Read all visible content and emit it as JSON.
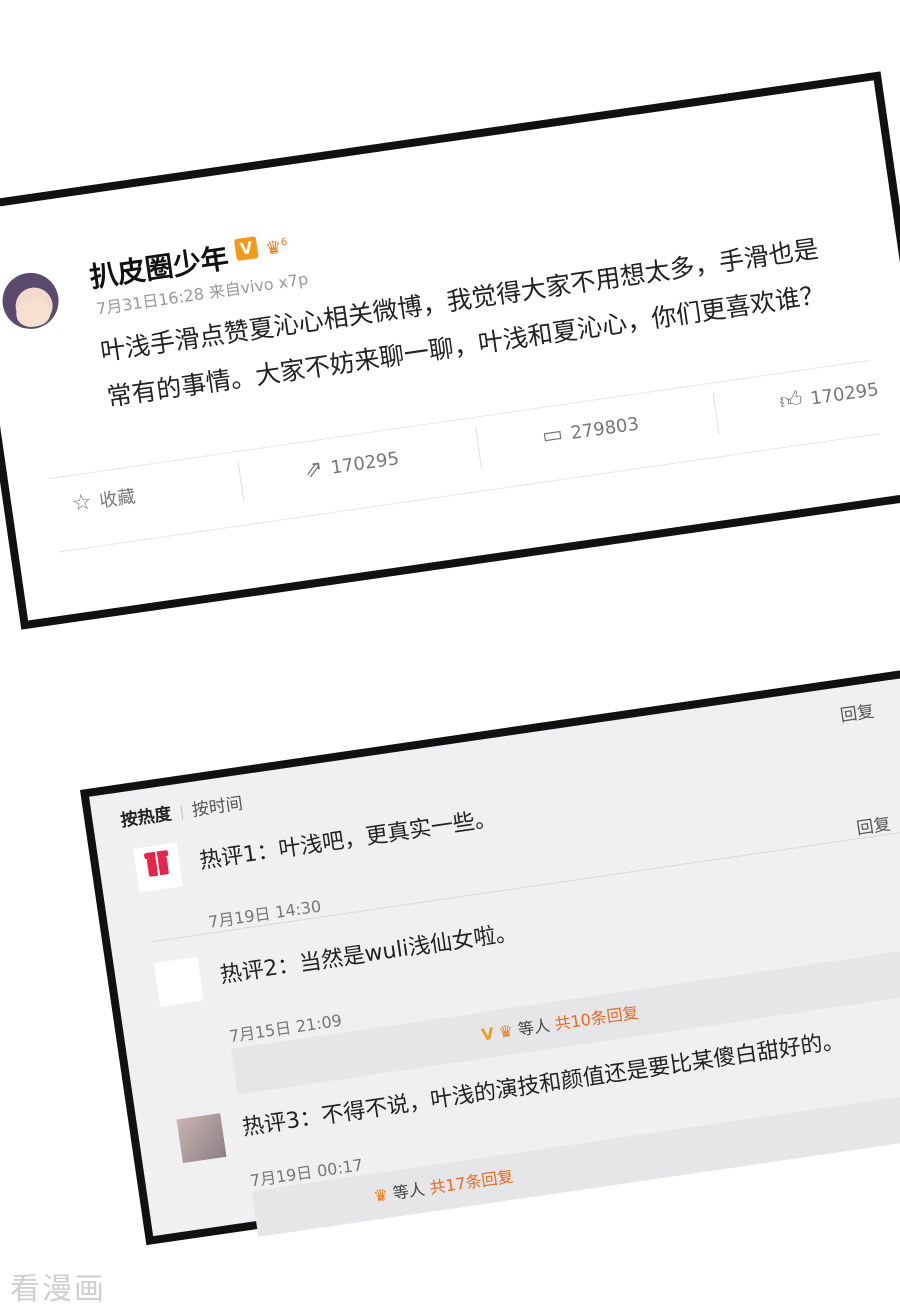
{
  "post": {
    "username": "扒皮圈少年",
    "v_badge": "V",
    "level_badge": "6",
    "meta": "7月31日16:28 来自vivo x7p",
    "body": "叶浅手滑点赞夏沁心相关微博，我觉得大家不用想太多，手滑也是常有的事情。大家不妨来聊一聊，叶浅和夏沁心，你们更喜欢谁？",
    "actions": {
      "like_count": "170295",
      "comment_count": "279803",
      "repost_count": "170295",
      "favorite_label": "收藏"
    },
    "icons": {
      "like": "thumb-up-icon",
      "comment": "comment-icon",
      "repost": "repost-icon",
      "favorite": "star-icon"
    }
  },
  "comments_panel": {
    "sort_hot": "按热度",
    "sort_time": "按时间",
    "reply_label": "回复",
    "comments": [
      {
        "text": "热评1：叶浅吧，更真实一些。",
        "time": "7月19日 14:30"
      },
      {
        "text": "热评2：当然是wuli浅仙女啦。",
        "time": "7月15日 21:09",
        "sub_prefix": "等人",
        "sub_count": "共10条回复",
        "sub_badge_v": "V"
      },
      {
        "text": "热评3：不得不说，叶浅的演技和颜值还是要比某傻白甜好的。",
        "time": "7月19日 00:17",
        "sub_prefix": "等人",
        "sub_count": "共17条回复"
      }
    ]
  },
  "watermark": "看漫画",
  "colors": {
    "accent_orange": "#e86a25",
    "vip_gold": "#f29a1c",
    "frame": "#111111",
    "panel_bg": "#f0f0f2"
  }
}
